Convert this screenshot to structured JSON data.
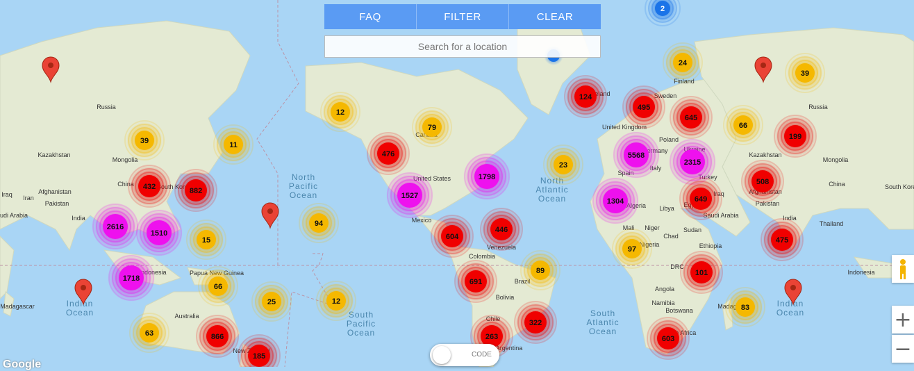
{
  "toolbar": {
    "faq": "FAQ",
    "filter": "FILTER",
    "clear": "CLEAR"
  },
  "search": {
    "placeholder": "Search for a location"
  },
  "toggle": {
    "label": "CODE"
  },
  "attribution": "Google",
  "zoom": {
    "in": "+",
    "out": "−"
  },
  "colors": {
    "small": "#f5b800",
    "medium": "#f00000",
    "large": "#ee11ee",
    "blue": "#1a73e8",
    "water": "#a9d5f5",
    "land": "#e6ecd6"
  },
  "clusters": [
    {
      "label": "2",
      "tier": "blue"
    },
    {
      "label": "24",
      "tier": "small"
    },
    {
      "label": "39",
      "tier": "small"
    },
    {
      "label": "124",
      "tier": "medium"
    },
    {
      "label": "495",
      "tier": "medium"
    },
    {
      "label": "645",
      "tier": "medium"
    },
    {
      "label": "12",
      "tier": "small"
    },
    {
      "label": "79",
      "tier": "small"
    },
    {
      "label": "66",
      "tier": "small"
    },
    {
      "label": "199",
      "tier": "medium"
    },
    {
      "label": "39",
      "tier": "small"
    },
    {
      "label": "11",
      "tier": "small"
    },
    {
      "label": "476",
      "tier": "medium"
    },
    {
      "label": "5568",
      "tier": "large"
    },
    {
      "label": "2315",
      "tier": "large"
    },
    {
      "label": "23",
      "tier": "small"
    },
    {
      "label": "432",
      "tier": "medium"
    },
    {
      "label": "882",
      "tier": "medium"
    },
    {
      "label": "1798",
      "tier": "large"
    },
    {
      "label": "1527",
      "tier": "large"
    },
    {
      "label": "508",
      "tier": "medium"
    },
    {
      "label": "1304",
      "tier": "large"
    },
    {
      "label": "649",
      "tier": "medium"
    },
    {
      "label": "2616",
      "tier": "large"
    },
    {
      "label": "1510",
      "tier": "large"
    },
    {
      "label": "94",
      "tier": "small"
    },
    {
      "label": "15",
      "tier": "small"
    },
    {
      "label": "604",
      "tier": "medium"
    },
    {
      "label": "446",
      "tier": "medium"
    },
    {
      "label": "475",
      "tier": "medium"
    },
    {
      "label": "97",
      "tier": "small"
    },
    {
      "label": "1718",
      "tier": "large"
    },
    {
      "label": "89",
      "tier": "small"
    },
    {
      "label": "101",
      "tier": "medium"
    },
    {
      "label": "691",
      "tier": "medium"
    },
    {
      "label": "66",
      "tier": "small"
    },
    {
      "label": "25",
      "tier": "small"
    },
    {
      "label": "12",
      "tier": "small"
    },
    {
      "label": "83",
      "tier": "small"
    },
    {
      "label": "63",
      "tier": "small"
    },
    {
      "label": "322",
      "tier": "medium"
    },
    {
      "label": "866",
      "tier": "medium"
    },
    {
      "label": "263",
      "tier": "medium"
    },
    {
      "label": "603",
      "tier": "medium"
    },
    {
      "label": "185",
      "tier": "medium"
    }
  ],
  "labels": {
    "russia1": "Russia",
    "kazakhstan1": "Kazakhstan",
    "mongolia1": "Mongolia",
    "china1": "China",
    "southkorea1": "South Korea",
    "afghanistan1": "Afghanistan",
    "pakistan1": "Pakistan",
    "iran1": "Iran",
    "iraq1": "Iraq",
    "saudi1": "udi Arabia",
    "india1": "India",
    "indonesia1": "Indonesia",
    "papua": "Papua New Guinea",
    "australia": "Australia",
    "nz": "New Zealand",
    "madagascar1": "Madagascar",
    "indian_ocean1": "Indian Ocean",
    "north_pacific": "North Pacific Ocean",
    "south_pacific": "South Pacific Ocean",
    "canada": "Canada",
    "us": "United States",
    "mexico": "Mexico",
    "venezuela": "Venezuela",
    "colombia": "Colombia",
    "brazil": "Brazil",
    "bolivia": "Bolivia",
    "chile": "Chile",
    "argentina": "Argentina",
    "north_atlantic": "North Atlantic Ocean",
    "south_atlantic": "South Atlantic Ocean",
    "iceland": "Iceland",
    "sweden": "Sweden",
    "finland": "Finland",
    "uk": "United Kingdom",
    "germany": "Germany",
    "poland": "Poland",
    "ukraine": "Ukraine",
    "italy": "Italy",
    "spain": "Spain",
    "turkey": "Turkey",
    "algeria": "Algeria",
    "libya": "Libya",
    "egypt": "Egypt",
    "iraq2": "Iraq",
    "saudi2": "Saudi Arabia",
    "mali": "Mali",
    "niger": "Niger",
    "chad": "Chad",
    "sudan": "Sudan",
    "nigeria": "Nigeria",
    "ethiopia": "Ethiopia",
    "drc": "DRC",
    "angola": "Angola",
    "namibia": "Namibia",
    "botswana": "Botswana",
    "southafrica": "South Africa",
    "madagascar2": "Madagascar",
    "russia2": "Russia",
    "kazakhstan2": "Kazakhstan",
    "mongolia2": "Mongolia",
    "china2": "China",
    "southkorea2": "South Korea",
    "afghanistan2": "Afghanistan",
    "pakistan2": "Pakistan",
    "india2": "India",
    "thailand": "Thailand",
    "indonesia2": "Indonesia",
    "indian_ocean2": "Indian Ocean"
  }
}
